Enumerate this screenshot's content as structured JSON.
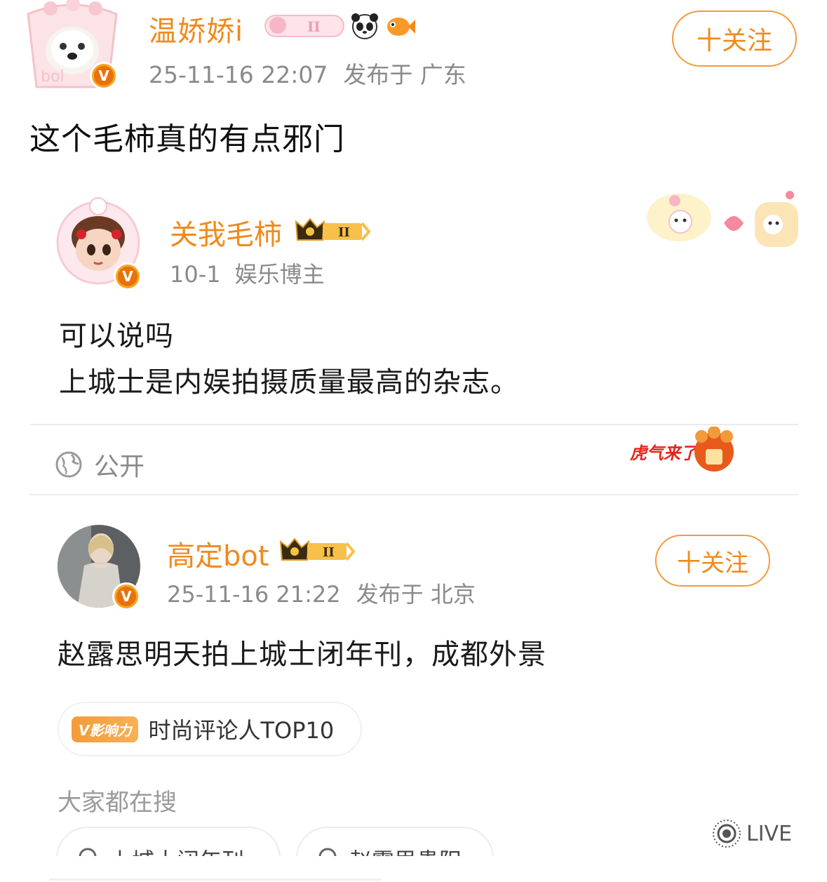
{
  "post": {
    "author": {
      "name": "温娇娇i",
      "avatar_icon": "puppy-cup-avatar",
      "verified_mark": "V"
    },
    "date": "25-11-16 22:07",
    "location": "发布于 广东",
    "follow_label": "十关注",
    "text": "这个毛柿真的有点邪门"
  },
  "repost_1": {
    "author": {
      "name": "关我毛柿",
      "avatar_icon": "doll-avatar",
      "verified_mark": "V",
      "level_badge": "II"
    },
    "date": "10-1",
    "tag": "娱乐博主",
    "text_lines": [
      "可以说吗",
      "上城士是内娱拍摄质量最高的杂志。"
    ],
    "visibility": "公开",
    "sticker_text": "虎气来了"
  },
  "repost_2": {
    "author": {
      "name": "高定bot",
      "avatar_icon": "model-photo-avatar",
      "verified_mark": "V",
      "level_badge": "II"
    },
    "date": "25-11-16 21:22",
    "location": "发布于 北京",
    "follow_label": "十关注",
    "text": "赵露思明天拍上城士闭年刊，成都外景",
    "influence": {
      "tag": "V影响力",
      "text": "时尚评论人TOP10"
    },
    "search_title": "大家都在搜",
    "search_chips": [
      "上城士闭年刊",
      "赵露思贵阳"
    ]
  },
  "live_label": "LIVE",
  "colors": {
    "accent_orange": "#f08a1c",
    "meta_gray": "#8a8a8a",
    "divider": "#ececec"
  }
}
